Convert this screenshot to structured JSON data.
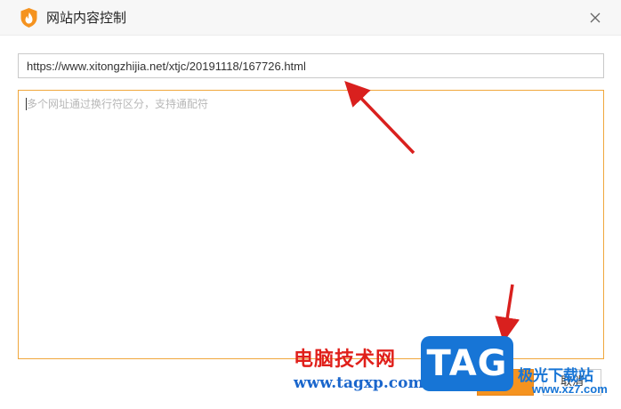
{
  "window": {
    "title": "网站内容控制",
    "close_icon": "close-icon",
    "logo_icon": "shield-flame-icon"
  },
  "url_field": {
    "value": "https://www.xitongzhijia.net/xtjc/20191118/167726.html"
  },
  "rules_field": {
    "placeholder": "多个网址通过换行符区分，支持通配符",
    "value": ""
  },
  "buttons": {
    "confirm_label": "",
    "cancel_label": "取消"
  },
  "watermark": {
    "cn_text": "电脑技术网",
    "url_text": "www.tagxp.com",
    "badge_text": "TAG",
    "site_cn": "极光下载站",
    "site_url": "www.xz7.com"
  },
  "colors": {
    "accent": "#f5931f",
    "textarea_border": "#f0a73c",
    "arrow": "#d9201e",
    "watermark_red": "#e0201b",
    "watermark_blue": "#1775d6"
  }
}
